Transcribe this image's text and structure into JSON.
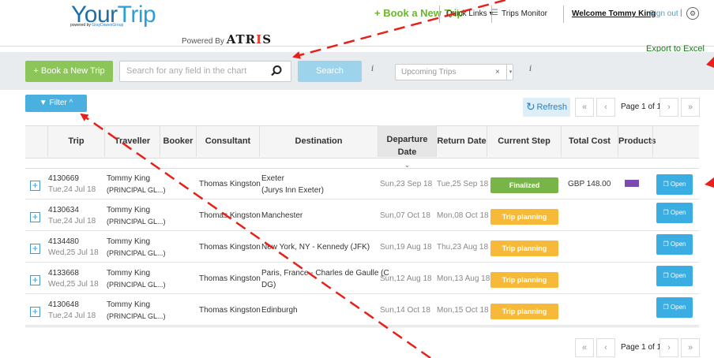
{
  "header": {
    "logo_your": "Your",
    "logo_trip": "Trip",
    "logo_sub_prefix": "powered by ",
    "logo_sub_brand": "GrayDawesGroup",
    "powered_by_label": "Powered By",
    "powered_by_brand_a": "ATR",
    "powered_by_brand_b": "I",
    "powered_by_brand_c": "S",
    "book_new_trip": "+ Book a New Trip",
    "quick_links": "Quick Links ▾",
    "trips_monitor": "Trips Monitor",
    "welcome": "Welcome Tommy King",
    "sign_out": "Sign out",
    "pipe": "|",
    "settings_icon": "gear-icon",
    "export": "Export to Excel"
  },
  "toolbar": {
    "book_new_trip": "+ Book a New Trip",
    "search_placeholder": "Search for any field in the chart",
    "search_button": "Search",
    "info": "i",
    "trip_filter_value": "Upcoming Trips",
    "clear": "×",
    "dropdown": "▾"
  },
  "filter_button": "Filter ^",
  "refresh_button": "Refresh",
  "pagination": {
    "first": "«",
    "prev": "‹",
    "label": "Page 1 of 1",
    "next": "›",
    "last": "»"
  },
  "table": {
    "columns": [
      "Trip",
      "Traveller",
      "Booker",
      "Consultant",
      "Destination",
      "Departure Date",
      "Return Date",
      "Current Step",
      "Total Cost",
      "Products"
    ],
    "sort_indicator": "⌄",
    "open_label": "Open",
    "rows": [
      {
        "trip": "4130669",
        "date": "Tue,24 Jul 18",
        "traveller": "Tommy King",
        "traveller_sub": "(PRINCIPAL GL...)",
        "booker": "",
        "consultant": "Thomas Kingston",
        "destination": "Exeter",
        "destination_sub": "(Jurys Inn Exeter)",
        "departure": "Sun,23 Sep 18",
        "return": "Tue,25 Sep 18",
        "step": "Finalized",
        "cost": "GBP 148.00",
        "product": "hotel-bed-icon"
      },
      {
        "trip": "4130634",
        "date": "Tue,24 Jul 18",
        "traveller": "Tommy King",
        "traveller_sub": "(PRINCIPAL GL...)",
        "booker": "",
        "consultant": "Thomas Kingston",
        "destination": "Manchester",
        "destination_sub": "",
        "departure": "Sun,07 Oct 18",
        "return": "Mon,08 Oct 18",
        "step": "Trip planning",
        "cost": "",
        "product": ""
      },
      {
        "trip": "4134480",
        "date": "Wed,25 Jul 18",
        "traveller": "Tommy King",
        "traveller_sub": "(PRINCIPAL GL...)",
        "booker": "",
        "consultant": "Thomas Kingston",
        "destination": "New York, NY - Kennedy (JFK)",
        "destination_sub": "",
        "departure": "Sun,19 Aug 18",
        "return": "Thu,23 Aug 18",
        "step": "Trip planning",
        "cost": "",
        "product": ""
      },
      {
        "trip": "4133668",
        "date": "Wed,25 Jul 18",
        "traveller": "Tommy King",
        "traveller_sub": "(PRINCIPAL GL...)",
        "booker": "",
        "consultant": "Thomas Kingston",
        "destination": "Paris, France - Charles de Gaulle (C",
        "destination_sub": "DG)",
        "departure": "Sun,12 Aug 18",
        "return": "Mon,13 Aug 18",
        "step": "Trip planning",
        "cost": "",
        "product": ""
      },
      {
        "trip": "4130648",
        "date": "Tue,24 Jul 18",
        "traveller": "Tommy King",
        "traveller_sub": "(PRINCIPAL GL...)",
        "booker": "",
        "consultant": "Thomas Kingston",
        "destination": "Edinburgh",
        "destination_sub": "",
        "departure": "Sun,14 Oct 18",
        "return": "Mon,15 Oct 18",
        "step": "Trip planning",
        "cost": "",
        "product": ""
      }
    ]
  },
  "colors": {
    "green": "#8cc55a",
    "blue": "#3aaee3",
    "finalized": "#78b548",
    "planning": "#f6b93a",
    "annotation_arrow": "#e8201a"
  }
}
